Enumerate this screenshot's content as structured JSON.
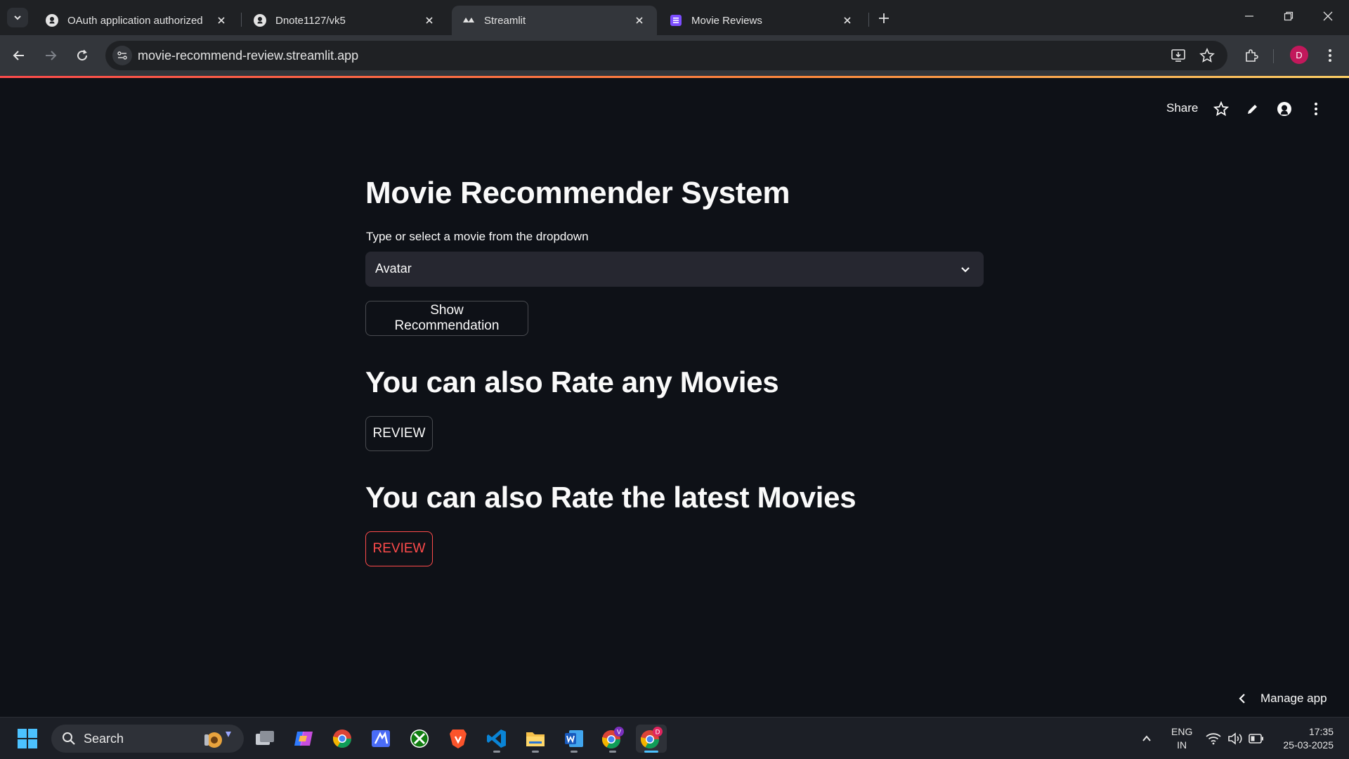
{
  "browser": {
    "tabs": [
      {
        "title": "OAuth application authorized",
        "icon": "github-icon",
        "active": false
      },
      {
        "title": "Dnote1127/vk5",
        "icon": "github-icon",
        "active": false
      },
      {
        "title": "Streamlit",
        "icon": "streamlit-icon",
        "active": true
      },
      {
        "title": "Movie Reviews",
        "icon": "forms-icon",
        "active": false
      }
    ],
    "url": "movie-recommend-review.streamlit.app",
    "profile_initial": "D"
  },
  "streamlit_header": {
    "share_label": "Share"
  },
  "app": {
    "title": "Movie Recommender System",
    "select": {
      "label": "Type or select a movie from the dropdown",
      "value": "Avatar"
    },
    "show_button": "Show Recommendation",
    "section1": {
      "heading": "You can also Rate any Movies",
      "button": "REVIEW"
    },
    "section2": {
      "heading": "You can also Rate the latest Movies",
      "button": "REVIEW"
    },
    "manage_app": "Manage app"
  },
  "colors": {
    "background": "#0e1117",
    "accent": "#ff4b4b",
    "selectbox": "#262730"
  },
  "taskbar": {
    "search_label": "Search",
    "lang_line1": "ENG",
    "lang_line2": "IN",
    "time": "17:35",
    "date": "25-03-2025",
    "apps": [
      "file-explorer-icon",
      "copilot-icon",
      "chrome-icon",
      "notes-icon",
      "xbox-icon",
      "brave-icon",
      "vscode-icon",
      "folder-icon",
      "word-icon",
      "chrome-profile-v-icon",
      "chrome-profile-d-icon"
    ]
  }
}
